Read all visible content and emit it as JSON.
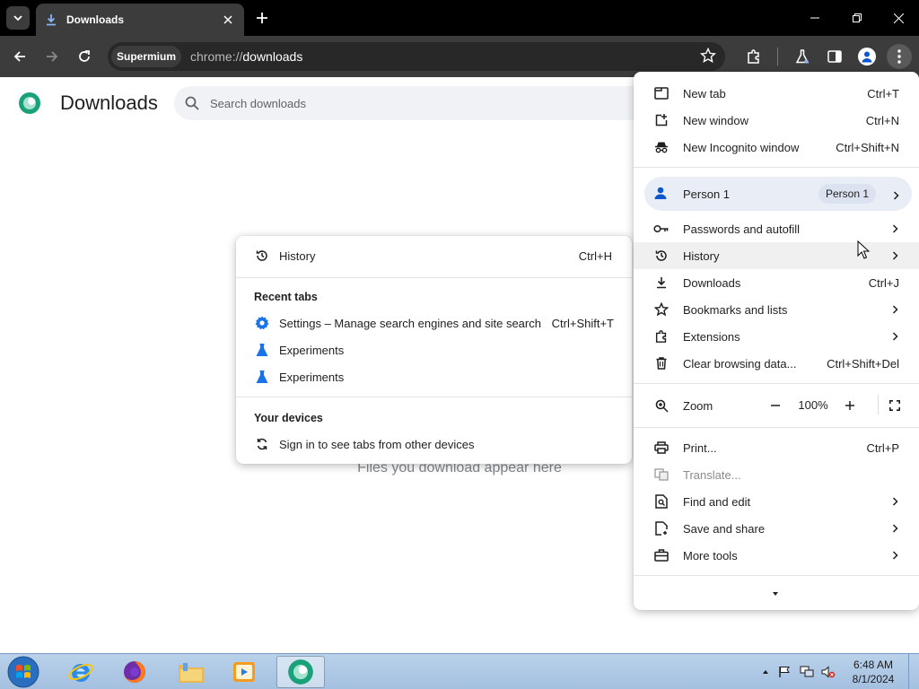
{
  "tabstrip": {
    "tab_title": "Downloads"
  },
  "toolbar": {
    "profile_chip": "Supermium",
    "url_scheme": "chrome://",
    "url_host": "downloads"
  },
  "page": {
    "title": "Downloads",
    "search_placeholder": "Search downloads",
    "empty_message": "Files you download appear here"
  },
  "main_menu": {
    "new_tab": {
      "label": "New tab",
      "shortcut": "Ctrl+T"
    },
    "new_window": {
      "label": "New window",
      "shortcut": "Ctrl+N"
    },
    "new_incognito": {
      "label": "New Incognito window",
      "shortcut": "Ctrl+Shift+N"
    },
    "person": {
      "label": "Person 1",
      "badge": "Person 1"
    },
    "passwords": {
      "label": "Passwords and autofill"
    },
    "history": {
      "label": "History"
    },
    "downloads": {
      "label": "Downloads",
      "shortcut": "Ctrl+J"
    },
    "bookmarks": {
      "label": "Bookmarks and lists"
    },
    "extensions": {
      "label": "Extensions"
    },
    "clear_data": {
      "label": "Clear browsing data...",
      "shortcut": "Ctrl+Shift+Del"
    },
    "zoom": {
      "label": "Zoom",
      "value": "100%"
    },
    "print": {
      "label": "Print...",
      "shortcut": "Ctrl+P"
    },
    "translate": {
      "label": "Translate..."
    },
    "find_edit": {
      "label": "Find and edit"
    },
    "save_share": {
      "label": "Save and share"
    },
    "more_tools": {
      "label": "More tools"
    }
  },
  "history_submenu": {
    "history": {
      "label": "History",
      "shortcut": "Ctrl+H"
    },
    "recent_tabs_header": "Recent tabs",
    "recent_tabs": [
      {
        "label": "Settings – Manage search engines and site search",
        "shortcut": "Ctrl+Shift+T",
        "icon": "gear-icon"
      },
      {
        "label": "Experiments",
        "icon": "flask-icon"
      },
      {
        "label": "Experiments",
        "icon": "flask-icon"
      }
    ],
    "your_devices_header": "Your devices",
    "sign_in": {
      "label": "Sign in to see tabs from other devices"
    }
  },
  "taskbar": {
    "time": "6:48 AM",
    "date": "8/1/2024"
  },
  "colors": {
    "accent": "#0b57d0",
    "toolbar": "#3c3c3c",
    "tabstrip": "#000000"
  }
}
